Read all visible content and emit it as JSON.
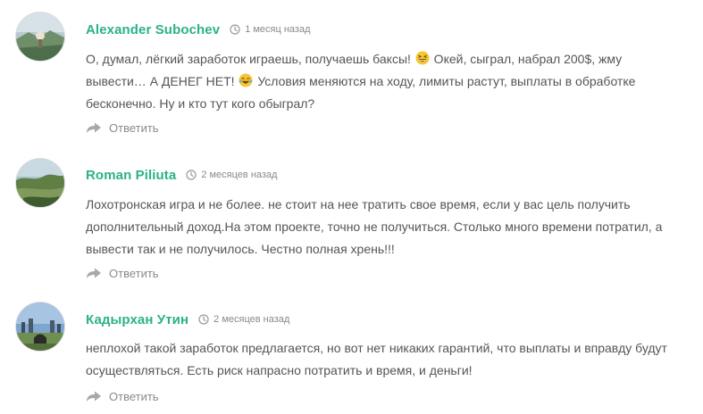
{
  "comments": [
    {
      "author": "Alexander Subochev",
      "time": "1 месяц назад",
      "text_parts": [
        "О, думал, лёгкий заработок играешь, получаешь баксы! ",
        " Окей, сыграл, набрал 200$, жму вывести… А ДЕНЕГ НЕТ! ",
        " Условия меняются на ходу, лимиты растут, выплаты в обработке бесконечно. Ну и кто тут кого обыграл?"
      ],
      "emojis": [
        "grinning-squinting-face-emoji",
        "tears-of-joy-emoji"
      ],
      "reply_label": "Ответить"
    },
    {
      "author": "Roman Piliuta",
      "time": "2 месяцев назад",
      "text": "Лохотронская игра и не более. не стоит на нее тратить свое время, если у вас цель получить дополнительный доход.На этом проекте, точно не получиться. Столько много времени потратил, а вывести так и не получилось. Честно полная хрень!!!",
      "reply_label": "Ответить"
    },
    {
      "author": "Кадырхан Утин",
      "time": "2 месяцев назад",
      "text": "неплохой такой заработок предлагается, но вот нет никаких гарантий, что выплаты и вправду будут осуществляться. Есть риск напрасно потратить и время, и деньги!",
      "reply_label": "Ответить"
    }
  ],
  "colors": {
    "author": "#2ab28a",
    "text": "#555555",
    "muted": "#8a8a8a"
  },
  "icons": {
    "time": "clock-icon",
    "reply": "reply-arrow-icon"
  }
}
